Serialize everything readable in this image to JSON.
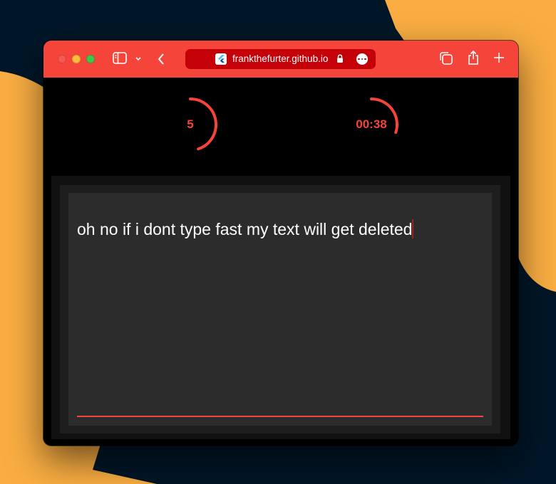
{
  "colors": {
    "background": "#001627",
    "accent_shape": "#f9ad42",
    "titlebar": "#f5443a",
    "urlbar": "#c40009",
    "timer_accent": "#f5443a",
    "text_field": "#2c2c2c"
  },
  "titlebar": {
    "traffic_lights": [
      "close",
      "minimize",
      "zoom"
    ],
    "sidebar_icon": "sidebar-icon",
    "back_icon": "chevron-left-icon",
    "url": "frankthefurter.github.io",
    "favicon": "flutter-icon",
    "lock_icon": "lock-icon",
    "more_icon": "ellipsis-icon",
    "tabs_icon": "tabs-overview-icon",
    "share_icon": "share-icon",
    "new_tab_icon": "plus-icon"
  },
  "timers": {
    "countdown": {
      "label": "5",
      "progress": 0.45
    },
    "elapsed": {
      "label": "00:38",
      "progress": 0.3
    }
  },
  "editor": {
    "text": "oh no if i dont type fast my text will get deleted"
  }
}
